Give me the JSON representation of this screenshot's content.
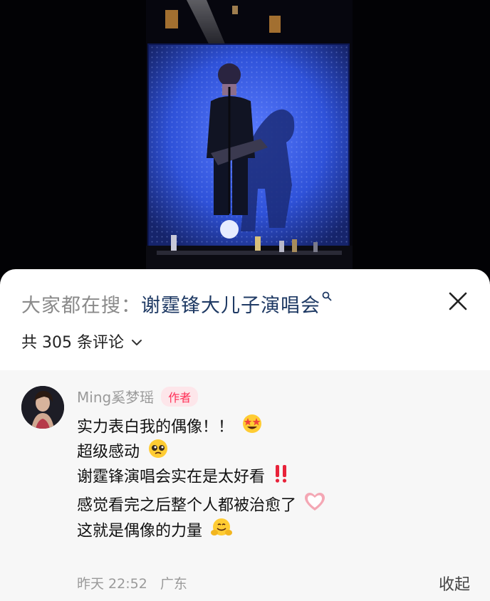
{
  "search": {
    "prefix": "大家都在搜：",
    "keyword": "谢霆锋大儿子演唱会",
    "icon": "search-icon"
  },
  "comments_header": {
    "count_label": "共 305 条评论",
    "chevron_icon": "chevron-down-icon"
  },
  "comment": {
    "username": "Ming奚梦瑶",
    "badge": "作者",
    "lines": [
      "实力表白我的偶像！！",
      "超级感动",
      "谢霆锋演唱会实在是太好看",
      "感觉看完之后整个人都被治愈了",
      "这就是偶像的力量"
    ],
    "time": "昨天 22:52",
    "location": "广东",
    "collapse_label": "收起"
  },
  "colors": {
    "keyword": "#1f3a64",
    "badge": "#ff2d55",
    "badge_bg": "#fde6ea",
    "screen_blue": "#2a4fd8"
  }
}
